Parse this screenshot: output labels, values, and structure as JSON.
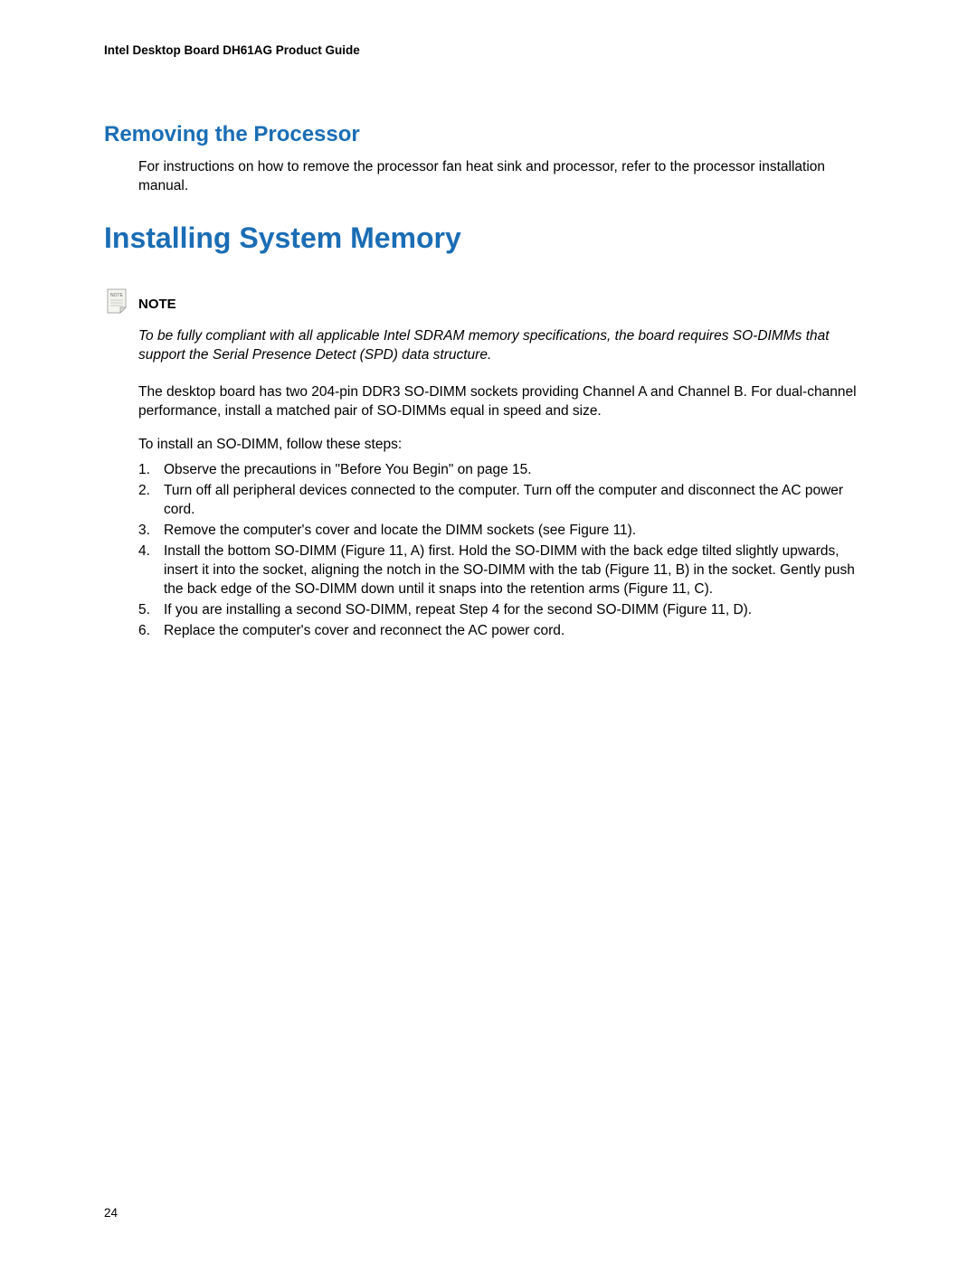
{
  "header": {
    "title": "Intel Desktop Board DH61AG Product Guide"
  },
  "section1": {
    "heading": "Removing the Processor",
    "body": "For instructions on how to remove the processor fan heat sink and processor, refer to the processor installation manual."
  },
  "section2": {
    "heading": "Installing System Memory",
    "note_label": "NOTE",
    "note_body": "To be fully compliant with all applicable Intel SDRAM memory specifications, the board requires SO-DIMMs that support the Serial Presence Detect (SPD) data structure.",
    "para1": "The desktop board has two 204-pin DDR3 SO-DIMM sockets providing Channel A and Channel B.  For dual-channel performance, install a matched pair of SO-DIMMs equal in speed and size.",
    "para2": "To install an SO-DIMM, follow these steps:",
    "steps": [
      "Observe the precautions in \"Before You Begin\" on page 15.",
      "Turn off all peripheral devices connected to the computer.  Turn off the computer and disconnect the AC power cord.",
      "Remove the computer's cover and locate the DIMM sockets (see Figure 11).",
      "Install the bottom SO-DIMM (Figure 11, A) first.  Hold the SO-DIMM with the back edge tilted slightly upwards, insert it into the socket, aligning the notch in the SO-DIMM with the tab (Figure 11, B) in the socket.  Gently push the back edge of the SO-DIMM down until it snaps into the retention arms (Figure 11, C).",
      "If you are installing a second SO-DIMM, repeat Step 4 for the second SO-DIMM (Figure 11, D).",
      "Replace the computer's cover and reconnect the AC power cord."
    ]
  },
  "page_number": "24"
}
